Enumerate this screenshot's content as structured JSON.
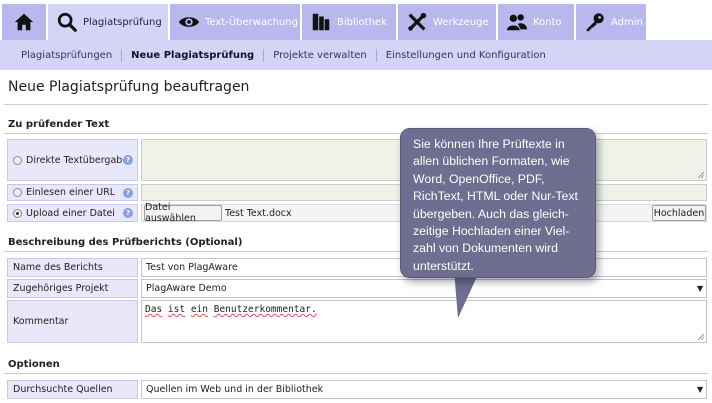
{
  "nav": {
    "home_icon": "home-icon",
    "tabs": [
      {
        "label": "Plagiatsprüfung",
        "icon": "search-icon",
        "active": true
      },
      {
        "label": "Text-Überwachung",
        "icon": "eye-icon",
        "active": false
      },
      {
        "label": "Bibliothek",
        "icon": "library-icon",
        "active": false
      },
      {
        "label": "Werkzeuge",
        "icon": "tools-icon",
        "active": false
      },
      {
        "label": "Konto",
        "icon": "users-icon",
        "active": false
      },
      {
        "label": "Admin",
        "icon": "key-icon",
        "active": false
      }
    ]
  },
  "subnav": {
    "items": [
      {
        "label": "Plagiatsprüfungen",
        "active": false
      },
      {
        "label": "Neue Plagiatsprüfung",
        "active": true
      },
      {
        "label": "Projekte verwalten",
        "active": false
      },
      {
        "label": "Einstellungen und Konfiguration",
        "active": false
      }
    ]
  },
  "page_title": "Neue Plagiatsprüfung beauftragen",
  "section_text": {
    "title": "Zu prüfender Text",
    "rows": [
      {
        "label": "Direkte Textübergabe",
        "selected": false
      },
      {
        "label": "Einlesen einer URL",
        "selected": false
      },
      {
        "label": "Upload einer Datei",
        "selected": true
      }
    ],
    "choose_file_label": "Datei auswählen",
    "file_name": "Test Text.docx",
    "upload_label": "Hochladen",
    "help_glyph": "?"
  },
  "section_report": {
    "title": "Beschreibung des Prüfberichts (Optional)",
    "name_label": "Name des Berichts",
    "name_value": "Test von PlagAware",
    "project_label": "Zugehöriges Projekt",
    "project_value": "PlagAware Demo",
    "comment_label": "Kommentar",
    "comment_words": [
      "Das",
      "ist",
      "ein",
      "Benutzerkommentar."
    ]
  },
  "section_options": {
    "title": "Optionen",
    "sources_label": "Durchsuchte Quellen",
    "sources_value": "Quellen im Web und in der Bibliothek"
  },
  "bubble": {
    "lines": [
      "Sie können Ihre Prüftexte in",
      "allen üblichen Formaten, wie",
      "Word, OpenOffice, PDF,",
      "RichText, HTML oder Nur-Text",
      "übergeben. Auch das gleich-",
      "zeitige Hochladen einer Viel-",
      "zahl von Dokumenten wird",
      "unterstützt."
    ]
  },
  "colors": {
    "tab": "#b8b8ee",
    "tab_active": "#d4d4f6",
    "label_cell": "#e8e8fa",
    "bubble": "#6d6e90"
  }
}
